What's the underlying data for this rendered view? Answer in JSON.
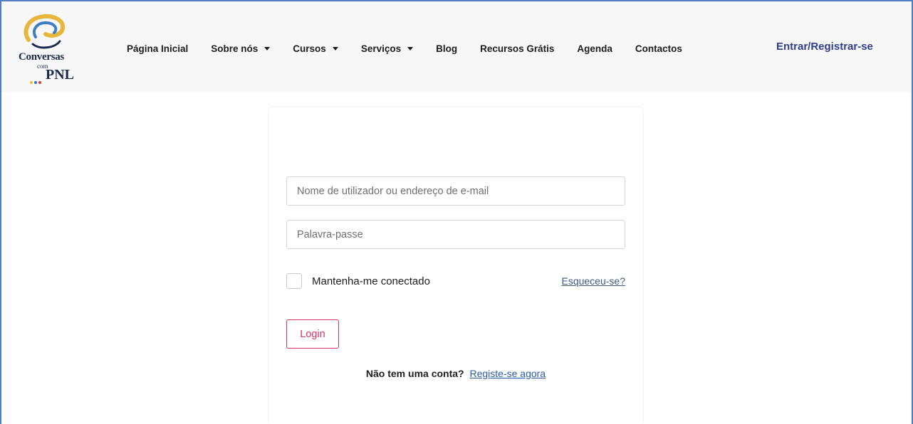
{
  "brand": {
    "logo_line1": "Conversas",
    "logo_line2": "com",
    "logo_line3": "PNL",
    "colors": {
      "swirl_gold": "#e7b73c",
      "swirl_blue": "#3c7fc4",
      "navy": "#1b2a4a",
      "dot_yellow": "#e8c21d",
      "dot_blue": "#2f6bd0",
      "dot_red": "#d8403a"
    }
  },
  "nav": {
    "items": [
      {
        "label": "Página Inicial",
        "dropdown": false
      },
      {
        "label": "Sobre nós",
        "dropdown": true
      },
      {
        "label": "Cursos",
        "dropdown": true
      },
      {
        "label": "Serviços",
        "dropdown": true
      },
      {
        "label": "Blog",
        "dropdown": false
      },
      {
        "label": "Recursos Grátis",
        "dropdown": false
      },
      {
        "label": "Agenda",
        "dropdown": false
      },
      {
        "label": "Contactos",
        "dropdown": false
      }
    ],
    "login_link": "Entrar/Registrar-se"
  },
  "login_form": {
    "username_placeholder": "Nome de utilizador ou endereço de e-mail",
    "username_value": "",
    "password_placeholder": "Palavra-passe",
    "password_value": "",
    "remember_label": "Mantenha-me conectado",
    "remember_checked": false,
    "forgot_link": "Esqueceu-se?",
    "submit_label": "Login",
    "no_account_text": "Não tem uma conta?",
    "register_link": "Registe-se agora"
  },
  "colors": {
    "frame": "#4f7ec4",
    "header_bg": "#f7f7f8",
    "accent_link": "#2d3d8a",
    "login_button": "#d6335f"
  }
}
